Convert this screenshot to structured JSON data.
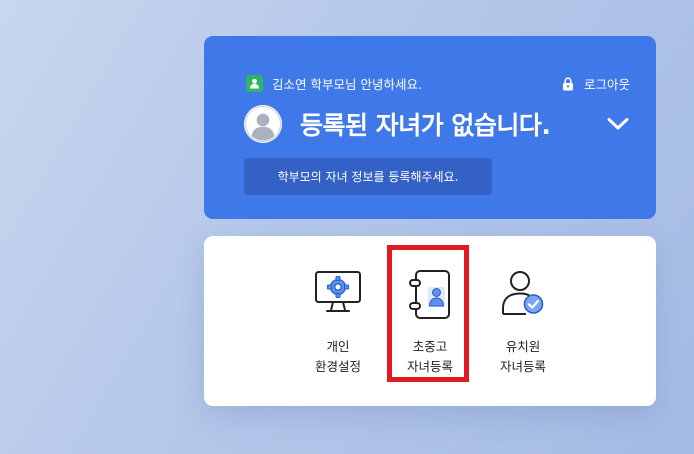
{
  "header": {
    "greeting": "김소연 학부모님 안녕하세요.",
    "logout_label": "로그아웃",
    "headline": "등록된 자녀가 없습니다.",
    "register_prompt": "학부모의 자녀 정보를 등록해주세요."
  },
  "menu": {
    "items": [
      {
        "line1": "개인",
        "line2": "환경설정",
        "icon": "monitor-gear-icon"
      },
      {
        "line1": "초중고",
        "line2": "자녀등록",
        "icon": "student-notebook-icon"
      },
      {
        "line1": "유치원",
        "line2": "자녀등록",
        "icon": "child-check-icon"
      }
    ]
  },
  "colors": {
    "header_blue": "#3f78e8",
    "button_blue": "#3461c6",
    "highlight_red": "#e01b24",
    "badge_green": "#2fb36a"
  }
}
